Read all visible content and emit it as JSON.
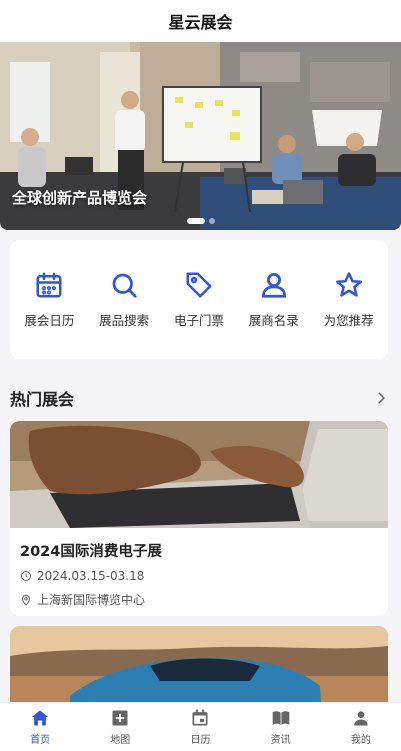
{
  "app": {
    "title": "星云展会"
  },
  "banner": {
    "caption": "全球创新产品博览会",
    "page_count": 2,
    "active_index": 0
  },
  "quick_menu": [
    {
      "label": "展会日历",
      "icon": "calendar-icon"
    },
    {
      "label": "展品搜索",
      "icon": "search-icon"
    },
    {
      "label": "电子门票",
      "icon": "tag-icon"
    },
    {
      "label": "展商名录",
      "icon": "user-icon"
    },
    {
      "label": "为您推荐",
      "icon": "star-icon"
    }
  ],
  "hot_section": {
    "title": "热门展会"
  },
  "exhibitions": [
    {
      "title": "2024国际消费电子展",
      "date": "2024.03.15-03.18",
      "venue": "上海新国际博览中心"
    }
  ],
  "tabbar": [
    {
      "label": "首页",
      "icon": "home-icon",
      "active": true
    },
    {
      "label": "地图",
      "icon": "map-add-icon",
      "active": false
    },
    {
      "label": "日历",
      "icon": "calendar-icon",
      "active": false
    },
    {
      "label": "资讯",
      "icon": "book-icon",
      "active": false
    },
    {
      "label": "我的",
      "icon": "person-icon",
      "active": false
    }
  ],
  "colors": {
    "accent": "#2f57d6",
    "icon_gray": "#666666"
  }
}
